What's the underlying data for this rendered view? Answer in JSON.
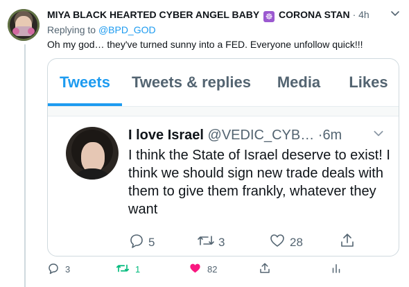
{
  "tweet": {
    "display_name": "MIYA BLACK HEARTED CYBER ANGEL BABY",
    "badge_icon": "wheel-of-dharma-icon",
    "display_name_suffix": "CORONA STAN",
    "separator": "·",
    "time": "4h",
    "replying_label": "Replying to",
    "replying_handle": "@BPD_GOD",
    "text": "Oh my god… they've turned sunny into a FED. Everyone unfollow quick!!!",
    "actions": {
      "reply_count": "3",
      "retweet_count": "1",
      "like_count": "82"
    }
  },
  "embedded": {
    "tabs": [
      "Tweets",
      "Tweets & replies",
      "Media",
      "Likes"
    ],
    "active_tab": "Tweets",
    "name": "I love Israel",
    "handle": "@VEDIC_CYB…",
    "separator": "·",
    "time": "6m",
    "text": "I think the State of Israel deserve to exist! I think we should sign new trade deals with them to give them frankly, whatever they want",
    "actions": {
      "reply_count": "5",
      "retweet_count": "3",
      "like_count": "28"
    }
  },
  "colors": {
    "accent": "#1d9bf0",
    "retweet": "#00ba7c",
    "like": "#f91880",
    "muted": "#536471"
  }
}
